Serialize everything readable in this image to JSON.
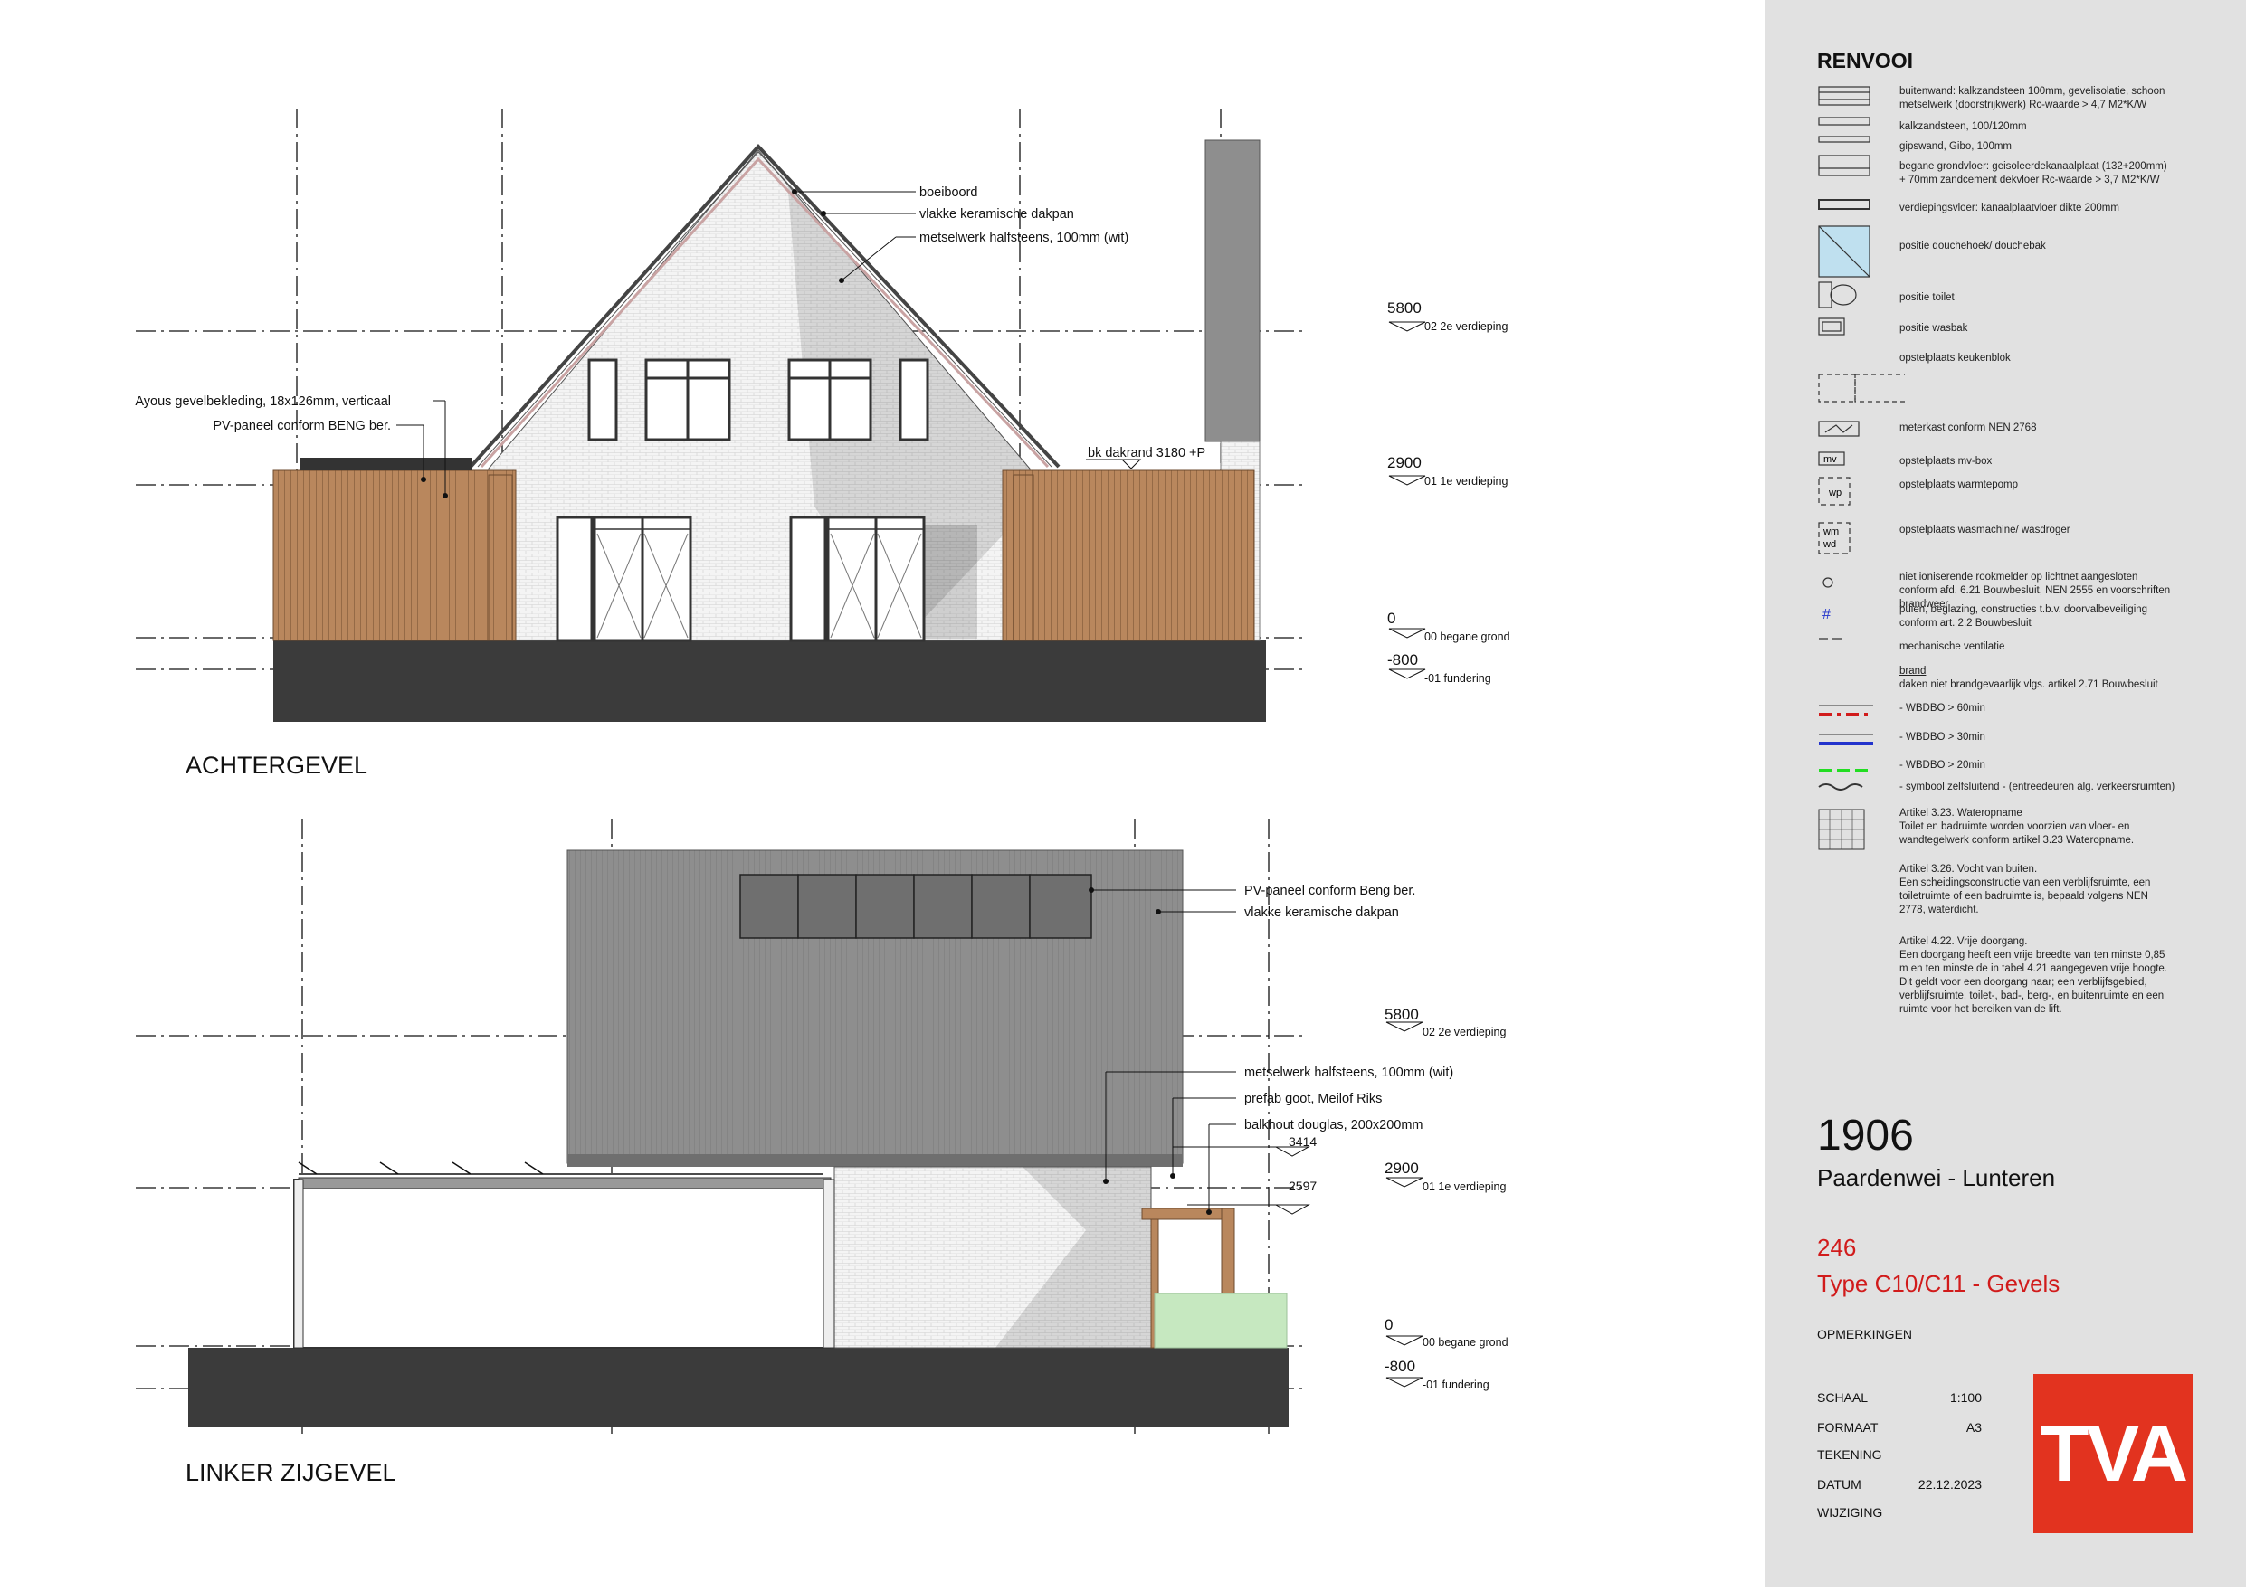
{
  "elevations": {
    "rear": {
      "title": "ACHTERGEVEL",
      "annotations": {
        "fascia": "boeiboord",
        "roof_tiles": "vlakke keramische dakpan",
        "masonry": "metselwerk halfsteens, 100mm (wit)",
        "cladding": "Ayous gevelbekleding, 18x126mm, verticaal",
        "pv": "PV-paneel conform BENG ber.",
        "eave": "bk dakrand 3180 +P"
      },
      "levels": [
        {
          "value": "5800",
          "label": "02 2e verdieping"
        },
        {
          "value": "2900",
          "label": "01 1e verdieping"
        },
        {
          "value": "0",
          "label": "00 begane grond"
        },
        {
          "value": "-800",
          "label": "-01 fundering"
        }
      ]
    },
    "left": {
      "title": "LINKER ZIJGEVEL",
      "annotations": {
        "pv": "PV-paneel conform Beng ber.",
        "roof_tiles": "vlakke keramische dakpan",
        "masonry": "metselwerk halfsteens, 100mm (wit)",
        "gutter": "prefab goot, Meilof Riks",
        "beam": "balkhout douglas, 200x200mm"
      },
      "dims": {
        "d1": "3414",
        "d2": "2597"
      },
      "levels": [
        {
          "value": "5800",
          "label": "02 2e verdieping"
        },
        {
          "value": "2900",
          "label": "01 1e verdieping"
        },
        {
          "value": "0",
          "label": "00 begane grond"
        },
        {
          "value": "-800",
          "label": "-01 fundering"
        }
      ]
    }
  },
  "legend": {
    "title": "RENVOOI",
    "items": [
      "buitenwand: kalkzandsteen 100mm, gevelisolatie, schoon metselwerk (doorstrijkwerk) Rc-waarde > 4,7 M2*K/W",
      "kalkzandsteen, 100/120mm",
      "gipswand, Gibo, 100mm",
      "begane grondvloer: geisoleerdekanaalplaat (132+200mm) + 70mm zandcement dekvloer Rc-waarde > 3,7 M2*K/W",
      "verdiepingsvloer: kanaalplaatvloer dikte 200mm",
      "positie douchehoek/ douchebak",
      "positie toilet",
      "positie wasbak",
      "opstelplaats keukenblok",
      "meterkast conform NEN 2768",
      "opstelplaats mv-box",
      "opstelplaats warmtepomp",
      "opstelplaats wasmachine/ wasdroger",
      "niet ioniserende rookmelder op lichtnet aangesloten conform afd. 6.21 Bouwbesluit, NEN 2555 en voorschriften brandweer",
      "puien, beglazing, constructies t.b.v. doorvalbeveiliging conform art. 2.2 Bouwbesluit",
      "mechanische ventilatie"
    ],
    "symbols": {
      "mvbox": "mv",
      "wp": "wp",
      "wm": "wm",
      "wd": "wd"
    },
    "brand_heading": "brand",
    "brand_note": "daken niet brandgevaarlijk vlgs. artikel 2.71 Bouwbesluit",
    "wbdbo": [
      "- WBDBO > 60min",
      "- WBDBO > 30min",
      "- WBDBO > 20min"
    ],
    "self_closing": "- symbool zelfsluitend - (entreedeuren alg. verkeersruimten)",
    "articles": [
      "Artikel 3.23. Wateropname\nToilet en badruimte worden voorzien van vloer- en wandtegelwerk conform artikel 3.23 Wateropname.",
      "Artikel 3.26. Vocht van buiten.\nEen scheidingsconstructie van een verblijfsruimte, een toiletruimte of een badruimte is, bepaald volgens NEN 2778, waterdicht.",
      "Artikel 4.22. Vrije doorgang.\nEen doorgang heeft een vrije breedte van ten minste 0,85 m en ten minste de in tabel 4.21 aangegeven vrije hoogte. Dit geldt voor een doorgang naar; een verblijfsgebied, verblijfsruimte, toilet-, bad-, berg-, en buitenruimte en een ruimte voor het bereiken van de lift."
    ]
  },
  "titleblock": {
    "project_number": "1906",
    "project_name": "Paardenwei - Lunteren",
    "drawing_number": "246",
    "drawing_title": "Type C10/C11 - Gevels",
    "remarks_label": "OPMERKINGEN",
    "scale_label": "SCHAAL",
    "scale_value": "1:100",
    "format_label": "FORMAAT",
    "format_value": "A3",
    "drawing_label": "TEKENING",
    "date_label": "DATUM",
    "date_value": "22.12.2023",
    "revision_label": "WIJZIGING",
    "logo_text": "TVA"
  },
  "colors": {
    "accent": "#d11b1b",
    "logo": "#e2331f",
    "panel": "#e1e1e1",
    "wood": "#b9875d",
    "ground": "#3b3b3b",
    "roof": "#8e8e8e",
    "glass_green": "#c6e8c0"
  }
}
